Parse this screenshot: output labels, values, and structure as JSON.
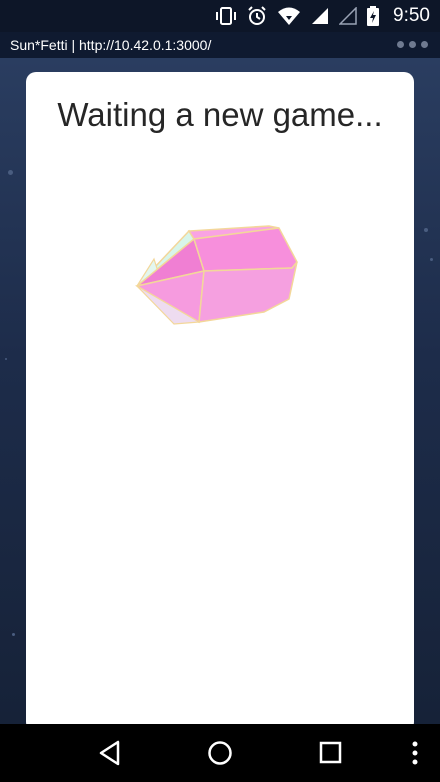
{
  "status_bar": {
    "time": "9:50",
    "icons": [
      "vibrate-icon",
      "alarm-icon",
      "wifi-icon",
      "signal-full-icon",
      "signal-empty-icon",
      "battery-charging-icon"
    ]
  },
  "browser": {
    "url_label": "Sun*Fetti | http://10.42.0.1:3000/",
    "menu_icon": "overflow-menu-icon"
  },
  "card": {
    "title": "Waiting a new game...",
    "gem_colors": {
      "face": "#f788d8",
      "accent": "#d8f5ea",
      "edge": "#f3d79a"
    }
  },
  "nav_bar": {
    "buttons": [
      "back-icon",
      "home-icon",
      "recents-icon",
      "more-icon"
    ]
  }
}
